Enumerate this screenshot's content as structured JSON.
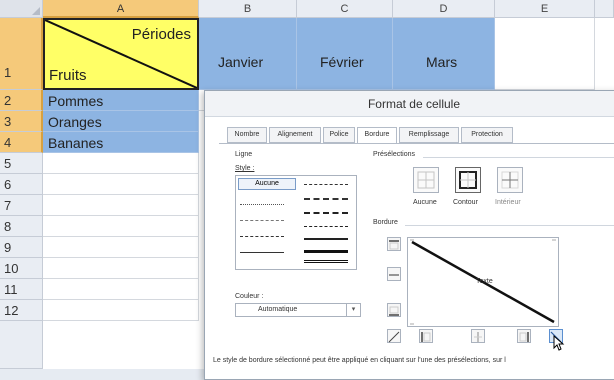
{
  "columns": [
    "A",
    "B",
    "C",
    "D",
    "E"
  ],
  "rows": [
    "1",
    "2",
    "3",
    "4",
    "5",
    "6",
    "7",
    "8",
    "9",
    "10",
    "11",
    "12"
  ],
  "cells": {
    "a1_periodes": "Périodes",
    "a1_fruits": "Fruits",
    "b1": "Janvier",
    "c1": "Février",
    "d1": "Mars",
    "a2": "Pommes",
    "a3": "Oranges",
    "a4": "Bananes"
  },
  "dialog": {
    "title": "Format de cellule",
    "tabs": [
      "Nombre",
      "Alignement",
      "Police",
      "Bordure",
      "Remplissage",
      "Protection"
    ],
    "active_tab": "Bordure",
    "ligne_label": "Ligne",
    "style_label": "Style :",
    "style_selected": "Aucune",
    "couleur_label": "Couleur :",
    "couleur_value": "Automatique",
    "preselections_label": "Présélections",
    "preset_aucune": "Aucune",
    "preset_contour": "Contour",
    "preset_interieur": "Intérieur",
    "bordure_label": "Bordure",
    "preview_text": "Texte",
    "hint": "Le style de bordure sélectionné peut être appliqué en cliquant sur l'une des présélections, sur l"
  },
  "colors": {
    "a1_fill": "#ffff66",
    "selection_blue": "#8db4e2",
    "header_selected": "#f5c97a"
  }
}
